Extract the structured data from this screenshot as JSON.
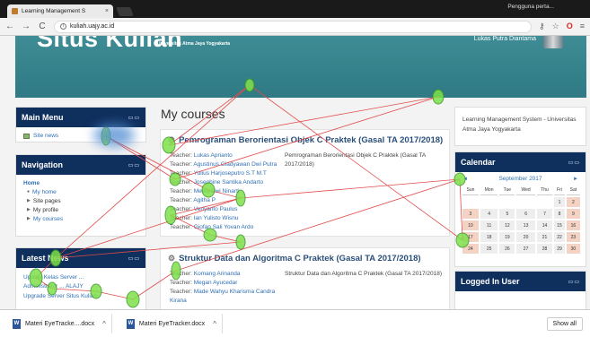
{
  "browser": {
    "tab_title": "Learning Management S",
    "tab_close": "×",
    "profile": "Pengguna perta...",
    "url": "kuliah.uajy.ac.id",
    "nav": {
      "back": "←",
      "forward": "→",
      "reload": "C",
      "info": "i"
    },
    "icons": {
      "key": "⚷",
      "star": "☆",
      "opera": "O",
      "menu": "≡"
    }
  },
  "site": {
    "title": "Situs Kuliah",
    "subtitle": "Universitas Atma Jaya Yogyakarta",
    "user_name": "Lukas Putra Diantama"
  },
  "main_menu": {
    "title": "Main Menu",
    "item": "Site news"
  },
  "navigation": {
    "title": "Navigation",
    "home": "Home",
    "items": [
      "My home",
      "Site pages",
      "My profile",
      "My courses"
    ]
  },
  "latest_news": {
    "title": "Latest News",
    "lines": [
      "Update Kelas Server ...",
      "Administrator ... ALAJY",
      "Upgrade Server Situs Kuliah"
    ]
  },
  "courses": {
    "heading": "My courses",
    "teacher_label": "Teacher:",
    "list": [
      {
        "title": "Pemrograman Berorientasi Objek C Praktek (Gasal TA 2017/2018)",
        "summary": "Pemrograman Berorientasi Objek C Praktek (Gasal TA 2017/2018)",
        "teachers": [
          "Lukas Aprianto",
          "Agustinus Gladyawan Dwi Putra",
          "Yulius Harjoseputro S.T M.T",
          "Josephine Santika Andarto",
          "Melita Dwi Ninarti",
          "Agitha P",
          "Veriyanto Paulus",
          "Ian Yulisto Wisnu",
          "Giofan Sali Yovan Ardo"
        ]
      },
      {
        "title": "Struktur Data dan Algoritma C Praktek (Gasal TA 2017/2018)",
        "summary": "Struktur Data dan Algoritma C Praktek (Gasal TA 2017/2018)",
        "teachers": [
          "Komang Arinanda",
          "Megan Ayucedar",
          "Made Wahyu Kharisma Candra Kirana"
        ]
      }
    ]
  },
  "lms_block": {
    "text": "Learning Management System - Universitas Atma Jaya Yogyakarta"
  },
  "calendar": {
    "title": "Calendar",
    "month": "September 2017",
    "prev": "◄",
    "next": "►",
    "days": [
      "Sun",
      "Mon",
      "Tue",
      "Wed",
      "Thu",
      "Fri",
      "Sat"
    ],
    "weeks": [
      [
        "",
        "",
        "",
        "",
        "",
        "1",
        "2"
      ],
      [
        "3",
        "4",
        "5",
        "6",
        "7",
        "8",
        "9"
      ],
      [
        "10",
        "11",
        "12",
        "13",
        "14",
        "15",
        "16"
      ],
      [
        "17",
        "18",
        "19",
        "20",
        "21",
        "22",
        "23"
      ],
      [
        "24",
        "25",
        "26",
        "27",
        "28",
        "29",
        "30"
      ]
    ]
  },
  "logged_in": {
    "title": "Logged In User"
  },
  "block_controls": "▭▭",
  "downloads": {
    "items": [
      "Materi EyeTracke....docx",
      "Materi EyeTracker.docx"
    ],
    "show_all": "Show all"
  },
  "colors": {
    "banner": "#3f8d96",
    "block_header": "#0f2f5d",
    "link": "#2f6fb4",
    "gaze_path": "#e24b4b",
    "fixation": "#7fe04a"
  }
}
